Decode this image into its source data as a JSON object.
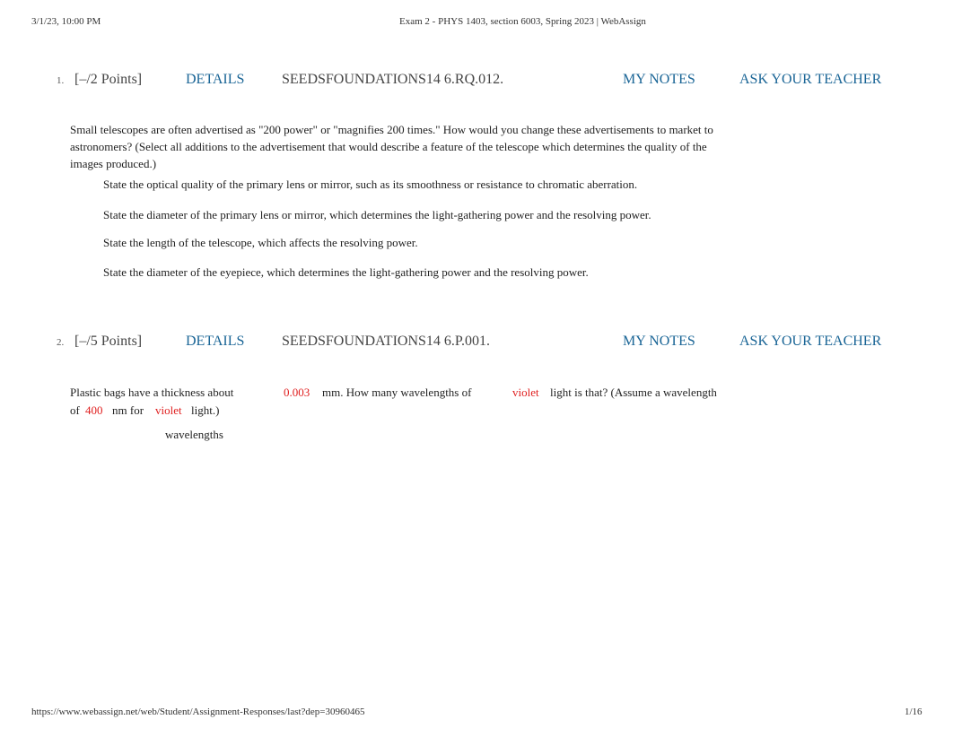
{
  "print_header": {
    "datetime": "3/1/23, 10:00 PM",
    "title": "Exam 2 - PHYS 1403, section 6003, Spring 2023 | WebAssign"
  },
  "print_footer": {
    "url": "https://www.webassign.net/web/Student/Assignment-Responses/last?dep=30960465",
    "page": "1/16"
  },
  "colors": {
    "link": "#1a6596",
    "variable": "#e02020"
  },
  "questions": [
    {
      "number": "1.",
      "points": "[–/2 Points]",
      "details_label": "DETAILS",
      "code": "SEEDSFOUNDATIONS14 6.RQ.012.",
      "my_notes_label": "MY NOTES",
      "ask_teacher_label": "ASK YOUR TEACHER",
      "prompt_lines": [
        "Small telescopes are often advertised as \"200 power\" or \"magnifies 200 times.\" How would you change these advertisements to market to",
        "astronomers? (Select all additions to the advertisement that would describe a feature of the telescope which determines the quality of the",
        "images produced.)"
      ],
      "options": [
        "State the optical quality of the primary lens or mirror, such as its smoothness or resistance to chromatic aberration.",
        "State the diameter of the primary lens or mirror, which determines the light-gathering power and the resolving power.",
        "State the length of the telescope, which affects the resolving power.",
        "State the diameter of the eyepiece, which determines the light-gathering power and the resolving power."
      ]
    },
    {
      "number": "2.",
      "points": "[–/5 Points]",
      "details_label": "DETAILS",
      "code": "SEEDSFOUNDATIONS14 6.P.001.",
      "my_notes_label": "MY NOTES",
      "ask_teacher_label": "ASK YOUR TEACHER",
      "prompt": {
        "t1": "Plastic bags have a thickness about",
        "v1": "0.003",
        "t2": "mm. How many wavelengths of",
        "v2": "violet",
        "t3": "light is that? (Assume a wavelength",
        "t4": "of",
        "v3": "400",
        "t5": "nm for",
        "v4": "violet",
        "t6": "light.)"
      },
      "answer_unit": "wavelengths"
    }
  ]
}
